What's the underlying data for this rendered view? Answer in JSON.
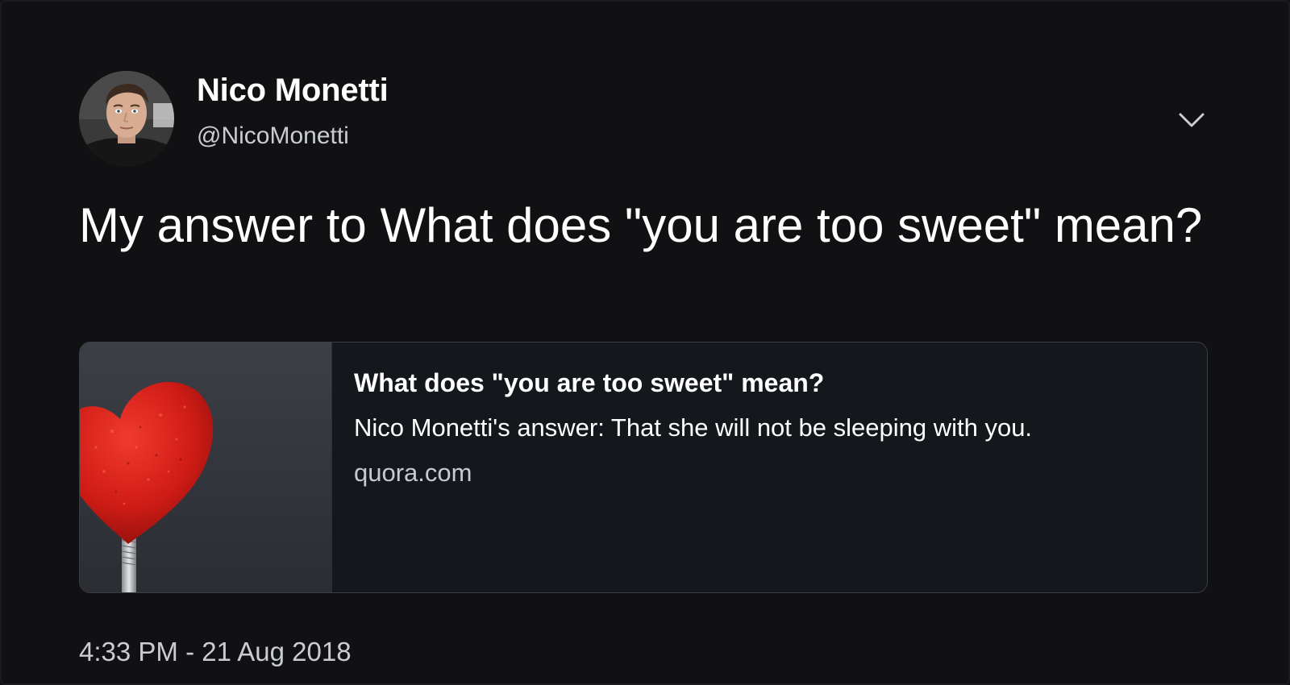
{
  "author": {
    "display_name": "Nico Monetti",
    "handle": "@NicoMonetti"
  },
  "tweet": {
    "text": "My answer to What does \"you are too sweet\" mean?",
    "timestamp": "4:33 PM - 21 Aug 2018"
  },
  "card": {
    "title": "What does \"you are too sweet\" mean?",
    "description": "Nico Monetti's answer: That she will not be sleeping with you.",
    "domain": "quora.com",
    "image": "red-heart-image"
  },
  "icons": {
    "menu": "chevron-down-icon"
  },
  "colors": {
    "background": "#111114",
    "text_primary": "#ffffff",
    "text_secondary": "#c9cdd2",
    "card_border": "#3a3e44",
    "card_background": "#14181c",
    "heart": "#d8201c"
  }
}
